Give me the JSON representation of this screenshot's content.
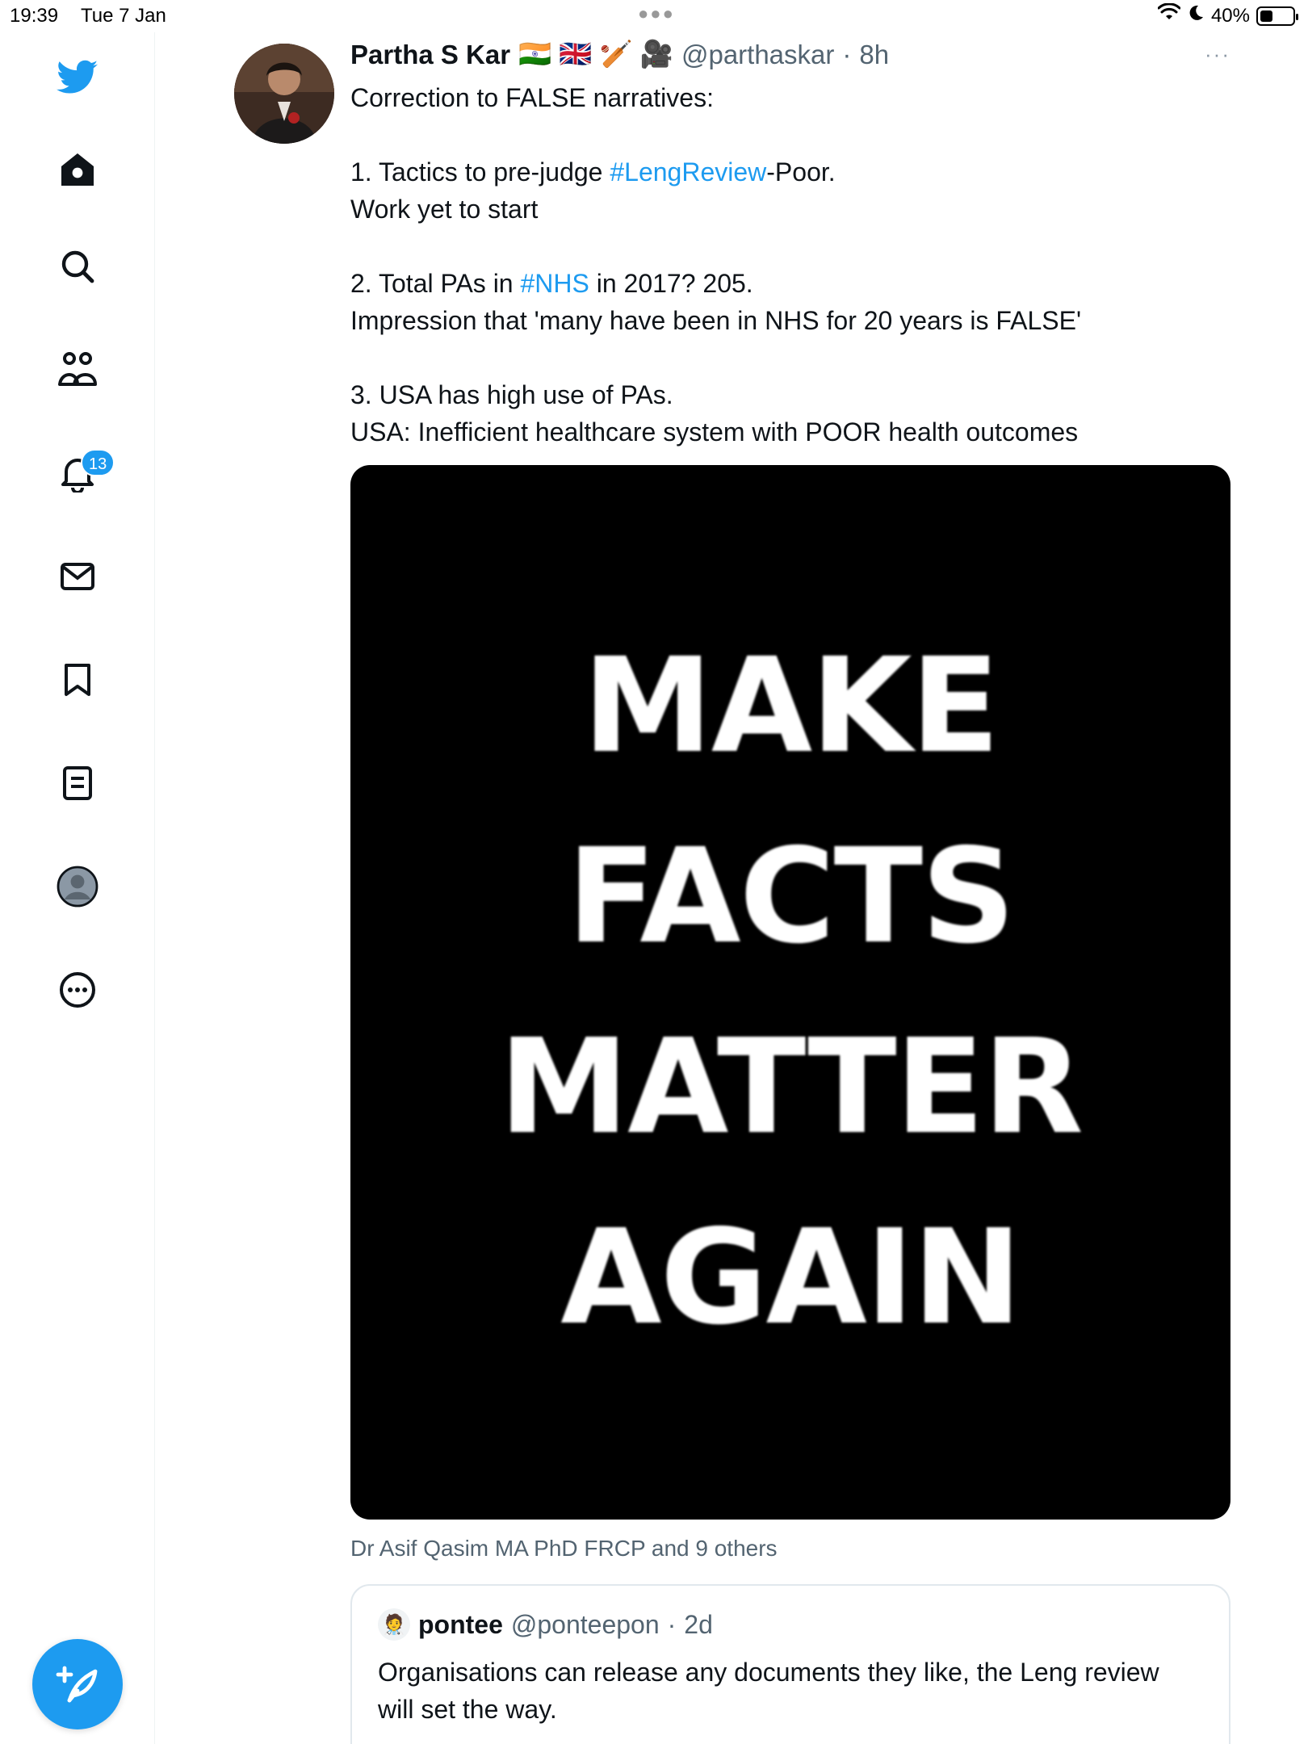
{
  "status_bar": {
    "time": "19:39",
    "date": "Tue 7 Jan",
    "battery_text": "40%",
    "battery_level": 0.4
  },
  "sidebar": {
    "notifications_badge": "13",
    "brand_color": "#1d9bf0",
    "items": [
      "bird-logo-icon",
      "home-icon",
      "search-icon",
      "communities-icon",
      "notifications-icon",
      "messages-icon",
      "bookmarks-icon",
      "lists-icon",
      "profile-icon",
      "more-icon"
    ]
  },
  "tweet": {
    "author_name": "Partha S Kar",
    "author_emojis": "🇮🇳 🇬🇧 🏏 🎥",
    "handle": "@parthaskar",
    "separator": "·",
    "time": "8h",
    "more": "···",
    "lines": [
      {
        "parts": [
          {
            "text": "Correction to FALSE narratives:"
          }
        ]
      },
      {
        "gap": true
      },
      {
        "parts": [
          {
            "text": "1. Tactics to pre-judge "
          },
          {
            "text": "#LengReview",
            "tag": true
          },
          {
            "text": "-Poor."
          }
        ]
      },
      {
        "parts": [
          {
            "text": "Work yet to start"
          }
        ]
      },
      {
        "gap": true
      },
      {
        "parts": [
          {
            "text": "2. Total PAs in "
          },
          {
            "text": "#NHS",
            "tag": true
          },
          {
            "text": " in 2017? 205."
          }
        ]
      },
      {
        "parts": [
          {
            "text": "Impression that 'many have been in NHS for 20 years is FALSE'"
          }
        ]
      },
      {
        "gap": true
      },
      {
        "parts": [
          {
            "text": "3. USA has high use of PAs."
          }
        ]
      },
      {
        "parts": [
          {
            "text": "USA: Inefficient healthcare system with POOR health outcomes"
          }
        ]
      }
    ],
    "image_text": [
      "MAKE",
      "FACTS",
      "MATTER",
      "AGAIN"
    ],
    "liked_by": "Dr Asif Qasim MA PhD FRCP and 9 others"
  },
  "quote": {
    "author_name": "pontee",
    "handle": "@ponteepon",
    "separator": "·",
    "time": "2d",
    "avatar_emoji": "🧑‍⚕️",
    "text": "Organisations can release any documents they like, the Leng review will set the way."
  }
}
